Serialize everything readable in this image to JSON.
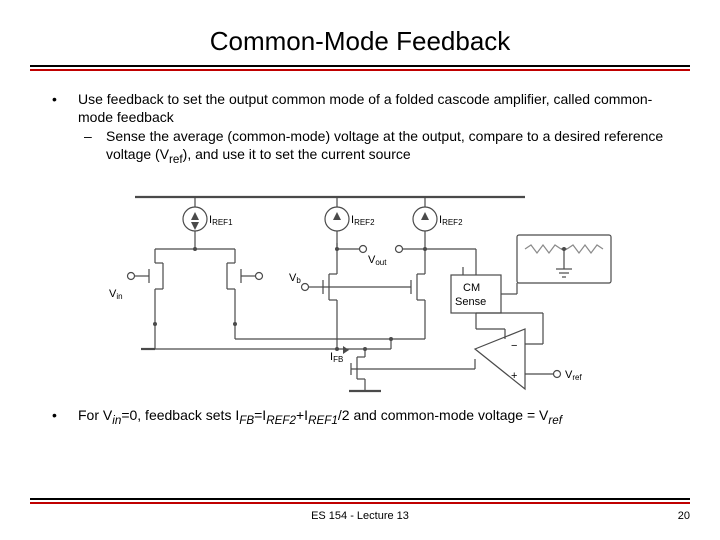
{
  "title": "Common-Mode Feedback",
  "bullets": {
    "b1_main": "Use feedback to set the output common mode of a folded cascode amplifier, called common-mode feedback",
    "b1_sub_a": "Sense the average (common-mode) voltage at the output, compare to a desired reference voltage (V",
    "b1_sub_ref": "ref",
    "b1_sub_b": "), and use it to set the current source",
    "b2_a": "For V",
    "b2_in": "in",
    "b2_b": "=0, feedback sets I",
    "b2_FB": "FB",
    "b2_c": "=I",
    "b2_REF2": "REF2",
    "b2_d": "+I",
    "b2_REF1": "REF1",
    "b2_e": "/2 and common-mode voltage = V",
    "b2_ref2": "ref"
  },
  "labels": {
    "IREF1": "I",
    "IREF1_sub": "REF1",
    "IREF2": "I",
    "IREF2_sub": "REF2",
    "Vin": "V",
    "Vin_sub": "in",
    "Vb": "V",
    "Vb_sub": "b",
    "Vout": "V",
    "Vout_sub": "out",
    "CM": "CM",
    "Sense": "Sense",
    "IFB": "I",
    "IFB_sub": "FB",
    "Vref": "V",
    "Vref_sub": "ref",
    "plus": "+",
    "minus": "−"
  },
  "footer": {
    "course": "ES 154 - Lecture 13",
    "page": "20"
  }
}
